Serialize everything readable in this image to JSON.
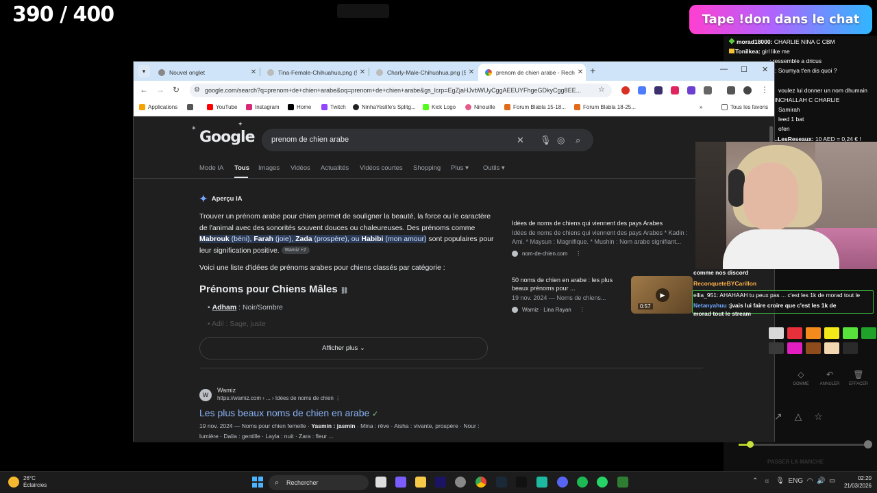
{
  "overlay": {
    "counter": "390 / 400",
    "don_banner": "Tape !don dans le chat"
  },
  "browser": {
    "tabs": [
      {
        "label": "Nouvel onglet",
        "active": false
      },
      {
        "label": "Tina-Female-Chihuahua.png (5...",
        "active": false
      },
      {
        "label": "Charly-Male-Chihuahua.png (5...",
        "active": false
      },
      {
        "label": "prenom de chien arabe - Reche...",
        "active": true
      }
    ],
    "url": "google.com/search?q=prenom+de+chien+arabe&oq=prenom+de+chien+arabe&gs_lcrp=EgZjaHJvbWUyCggAEEUYFhgeGDkyCgg8EE...",
    "bookmarks": [
      "Applications",
      "YouTube",
      "Instagram",
      "Home",
      "Twitch",
      "NinhaYeslife's Splitg...",
      "Kick Logo",
      "Ninouille",
      "Forum Blabla 15-18...",
      "Forum Blabla 18-25...",
      "Tous les favoris"
    ]
  },
  "search": {
    "logo": "Google",
    "query": "prenom de chien arabe",
    "tabs": [
      "Mode IA",
      "Tous",
      "Images",
      "Vidéos",
      "Actualités",
      "Vidéos courtes",
      "Shopping",
      "Plus ▾",
      "Outils ▾"
    ],
    "active_tab": "Tous"
  },
  "ai_overview": {
    "label": "Aperçu IA",
    "p1_a": "Trouver un prénom arabe pour chien permet de souligner la beauté, la force ou le caractère de l'animal avec des sonorités souvent douces ou chaleureuses. Des prénoms comme ",
    "n1": "Mabrouk",
    "m1": " (béni), ",
    "n2": "Farah",
    "m2": " (joie), ",
    "n3": "Zada",
    "m3": " (prospère), ou ",
    "n4": "Habibi",
    "m4": " (mon amour)",
    "p1_b": " sont populaires pour leur signification positive.",
    "chip": "Wamiz +2",
    "p2": "Voici une liste d'idées de prénoms arabes pour chiens classés par catégorie :",
    "heading": "Prénoms pour Chiens Mâles",
    "b1_name": "Adham",
    "b1_meaning": " : Noir/Sombre",
    "b2": "Adil : Sage, juste",
    "show_more": "Afficher plus"
  },
  "sources": [
    {
      "title": "Idées de noms de chiens qui viennent des pays Arabes",
      "desc": "Idées de noms de chiens qui viennent des pays Arabes * Kadin : Ami. * Maysun : Magnifique. * Mushin : Nom arabe signifiant...",
      "site": "nom-de-chien.com"
    },
    {
      "title": "50 noms de chien en arabe : les plus beaux prénoms pour ...",
      "desc": "19 nov. 2024 — Noms de chiens...",
      "site": "Wamiz · Lina Rayan",
      "duration": "0:57"
    }
  ],
  "result": {
    "site_initial": "W",
    "site": "Wamiz",
    "url": "https://wamiz.com › ... › Idées de noms de chien",
    "title": "Les plus beaux noms de chien en arabe",
    "snippet_a": "19 nov. 2024 — Noms pour chien femelle · ",
    "snippet_b": "Yasmin : jasmin",
    "snippet_c": " · Mina : rêve · Aisha : vivante, prospère · Nour : lumière · Dalia : gentille · Layla : nuit · Zara : fleur ..."
  },
  "chat": {
    "lines": [
      {
        "user": "morad18000:",
        "msg": " CHARLIE NINA C CBM"
      },
      {
        "user": "Tonilkea:",
        "msg": " girl like me"
      },
      {
        "user": "",
        "msg": "...: ressemble a dricus"
      },
      {
        "user": "",
        "msg": "...: Soumya t'en dis quoi ?"
      },
      {
        "user": "",
        "msg": "voulez lui donner un nom dhumain"
      },
      {
        "user": "",
        "msg": "INCHALLAH C CHARLIE"
      },
      {
        "user": "",
        "msg": "Samirah"
      },
      {
        "user": "",
        "msg": "leed 1 bat"
      },
      {
        "user": "",
        "msg": "ofen"
      },
      {
        "user": "...LesReseaux:",
        "msg": " 10 AED = 0,24 € !"
      }
    ],
    "overlay_top": "comme nos discord",
    "overlay_user1": "ReconqueteBYCarillon",
    "overlay_l2_user": "ellia_951:",
    "overlay_l2_msg": " AHAHAAH tu peux pas ... c'est les 1k de morad tout le",
    "overlay_l3_user": "Netanyahuu",
    "overlay_l3_msg": " :jvais lui faire croire que c'est les 1k de",
    "overlay_l4": "morad tout le stream",
    "tools": [
      "GOMME",
      "ANNULER",
      "EFFACER"
    ],
    "passer": "PASSER LA MANCHE",
    "colors": [
      "#d8d8d8",
      "#e8303a",
      "#f48a1c",
      "#f3e81a",
      "#58e23c",
      "#1fa12a",
      "#3a3a3a",
      "#e31ec0",
      "#8e4b1c",
      "#f2d7b0",
      "#2a2a2a"
    ]
  },
  "taskbar": {
    "temp": "26°C",
    "weather": "Éclaircies",
    "search": "Rechercher",
    "lang": "ENG",
    "time": "02:20",
    "date": "21/03/2026"
  }
}
